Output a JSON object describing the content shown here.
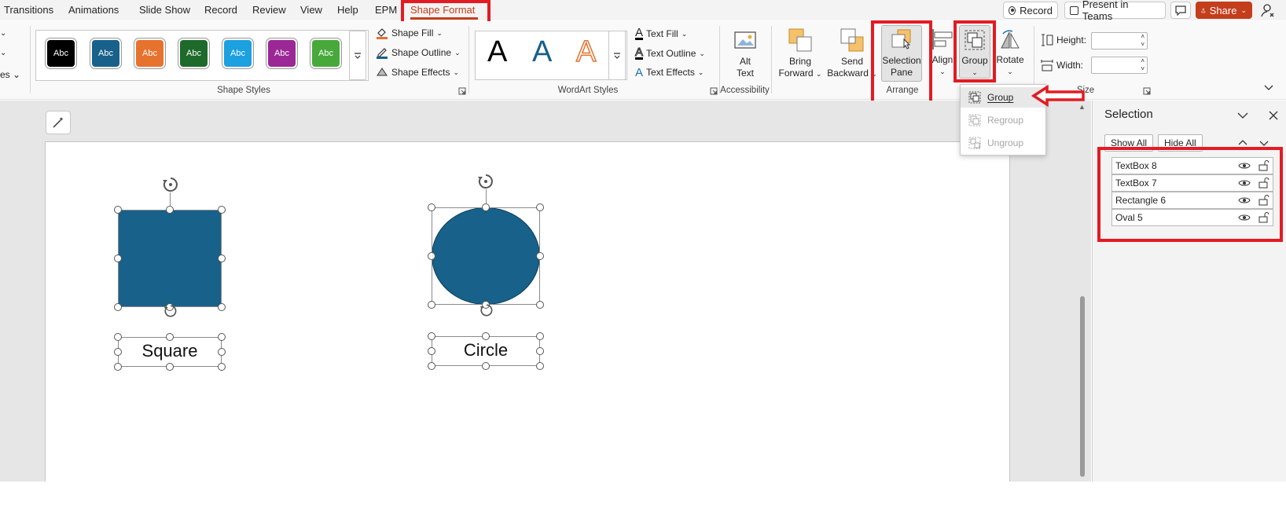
{
  "tabs": [
    {
      "label": "Transitions"
    },
    {
      "label": "Animations"
    },
    {
      "label": "Slide Show"
    },
    {
      "label": "Record"
    },
    {
      "label": "Review"
    },
    {
      "label": "View"
    },
    {
      "label": "Help"
    },
    {
      "label": "EPM"
    },
    {
      "label": "Shape Format"
    }
  ],
  "top_buttons": {
    "record": "Record",
    "present": "Present in Teams",
    "share": "Share"
  },
  "ribbon": {
    "left_cut": {
      "item1": "es"
    },
    "shape_styles": {
      "swatches": [
        {
          "label": "Abc",
          "color": "#000000"
        },
        {
          "label": "Abc",
          "color": "#17618a"
        },
        {
          "label": "Abc",
          "color": "#e6722e"
        },
        {
          "label": "Abc",
          "color": "#1d6a2a"
        },
        {
          "label": "Abc",
          "color": "#1ba0e0"
        },
        {
          "label": "Abc",
          "color": "#9b2896"
        },
        {
          "label": "Abc",
          "color": "#47a93a"
        }
      ],
      "fill": "Shape Fill",
      "outline": "Shape Outline",
      "effects": "Shape Effects",
      "label": "Shape Styles"
    },
    "wordart": {
      "letters": [
        "A",
        "A",
        "A"
      ],
      "text_fill": "Text Fill",
      "text_outline": "Text Outline",
      "text_effects": "Text Effects",
      "label": "WordArt Styles"
    },
    "accessibility": {
      "alt_text_line1": "Alt",
      "alt_text_line2": "Text",
      "label": "Accessibility"
    },
    "arrange": {
      "bring_forward_1": "Bring",
      "bring_forward_2": "Forward",
      "send_backward_1": "Send",
      "send_backward_2": "Backward",
      "selection_pane_1": "Selection",
      "selection_pane_2": "Pane",
      "align": "Align",
      "group": "Group",
      "rotate": "Rotate",
      "label": "Arrange"
    },
    "size": {
      "height": "Height:",
      "width": "Width:",
      "label": "Size"
    }
  },
  "group_menu": {
    "items": [
      {
        "label": "Group",
        "enabled": true
      },
      {
        "label": "Regroup",
        "enabled": false
      },
      {
        "label": "Ungroup",
        "enabled": false
      }
    ]
  },
  "slide": {
    "square_label": "Square",
    "circle_label": "Circle",
    "shape_color": "#17618a"
  },
  "selection_pane": {
    "title": "Selection",
    "show_all": "Show All",
    "hide_all": "Hide All",
    "items": [
      {
        "name": "TextBox 8"
      },
      {
        "name": "TextBox 7"
      },
      {
        "name": "Rectangle 6"
      },
      {
        "name": "Oval 5"
      }
    ]
  },
  "colors": {
    "accent": "#c43e1c",
    "annotation_red": "#e31b23"
  }
}
